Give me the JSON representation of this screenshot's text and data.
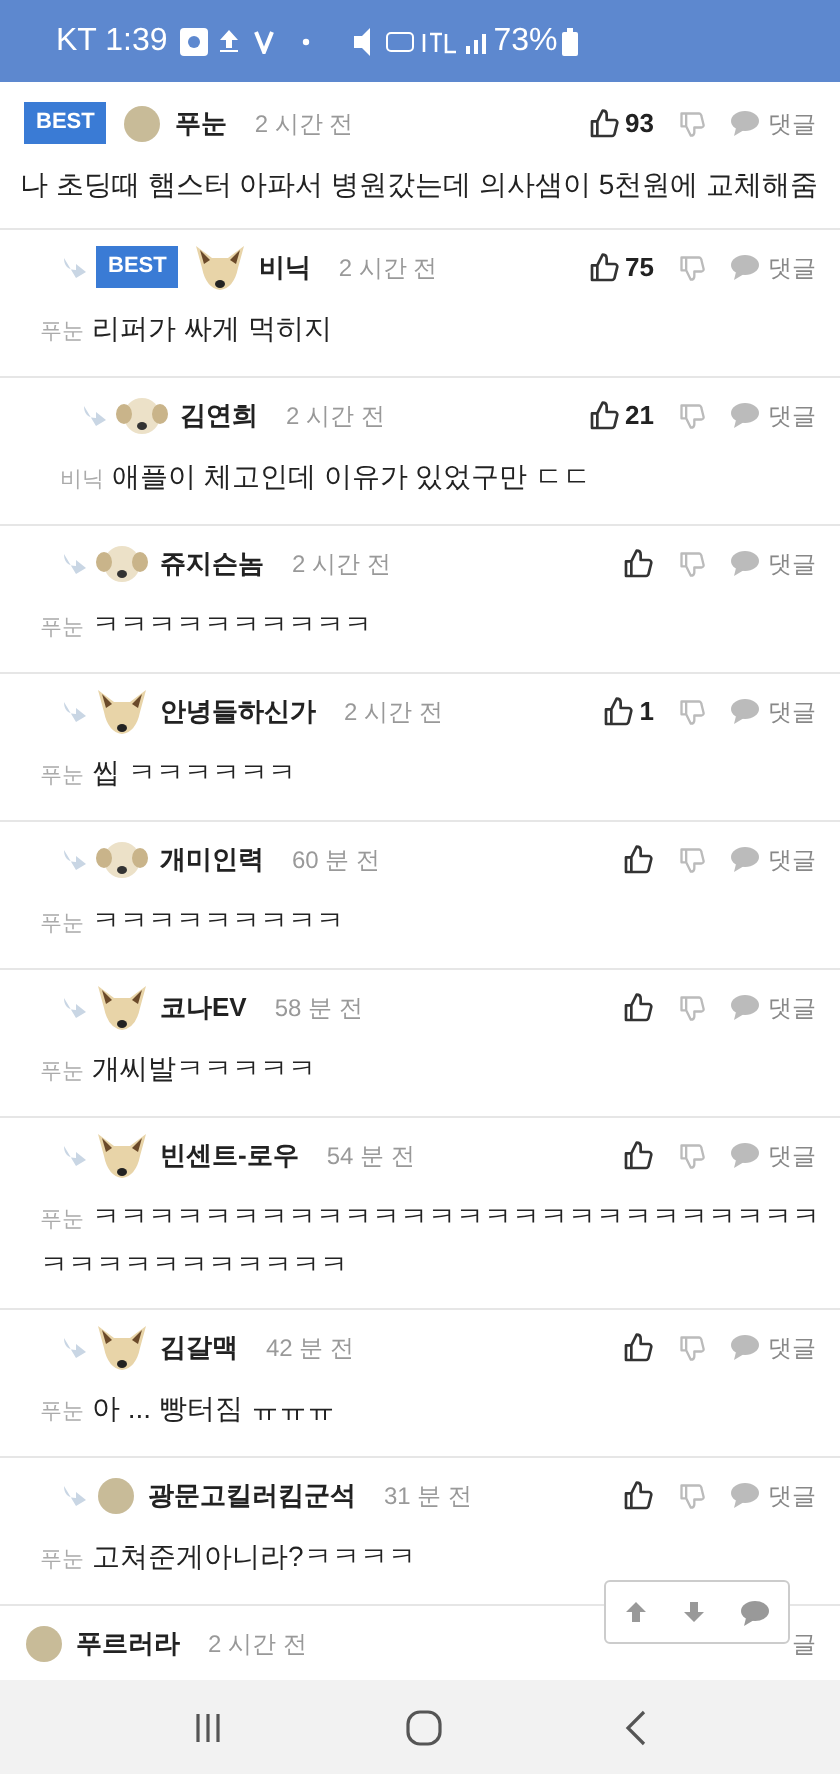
{
  "status_bar": {
    "carrier_time": "KT 1:39",
    "battery": "73%"
  },
  "comments": [
    {
      "badge": "BEST",
      "avatar": {
        "kind": "plain"
      },
      "author": "푸눈",
      "time": "2 시간 전",
      "likes": "93",
      "reply_label": "댓글",
      "text": "나 초딩때 햄스터 아파서 병원갔는데 의사샘이 5천원에 교체해줌",
      "children": [
        {
          "badge": "BEST",
          "avatar": {
            "kind": "dog"
          },
          "author": "비닉",
          "time": "2 시간 전",
          "likes": "75",
          "reply_label": "댓글",
          "mention": "푸눈",
          "text": "리퍼가 싸게 먹히지",
          "children": [
            {
              "avatar": {
                "kind": "puppy"
              },
              "author": "김연희",
              "time": "2 시간 전",
              "likes": "21",
              "reply_label": "댓글",
              "mention": "비닉",
              "text": "애플이 체고인데 이유가 있었구만 ㄷㄷ"
            }
          ]
        },
        {
          "avatar": {
            "kind": "puppy"
          },
          "author": "쥬지슨놈",
          "time": "2 시간 전",
          "reply_label": "댓글",
          "mention": "푸눈",
          "text": "ㅋㅋㅋㅋㅋㅋㅋㅋㅋㅋ"
        },
        {
          "avatar": {
            "kind": "dog"
          },
          "author": "안녕들하신가",
          "time": "2 시간 전",
          "likes": "1",
          "reply_label": "댓글",
          "mention": "푸눈",
          "text": "씹 ㅋㅋㅋㅋㅋㅋ"
        },
        {
          "avatar": {
            "kind": "puppy"
          },
          "author": "개미인력",
          "time": "60 분 전",
          "reply_label": "댓글",
          "mention": "푸눈",
          "text": "ㅋㅋㅋㅋㅋㅋㅋㅋㅋ"
        },
        {
          "avatar": {
            "kind": "dog"
          },
          "author": "코나EV",
          "time": "58 분 전",
          "reply_label": "댓글",
          "mention": "푸눈",
          "text": "개씨발ㅋㅋㅋㅋㅋ"
        },
        {
          "avatar": {
            "kind": "dog"
          },
          "author": "빈센트-로우",
          "time": "54 분 전",
          "reply_label": "댓글",
          "mention": "푸눈",
          "text": "ㅋㅋㅋㅋㅋㅋㅋㅋㅋㅋㅋㅋㅋㅋㅋㅋㅋㅋㅋㅋㅋㅋㅋㅋㅋㅋㅋㅋㅋㅋㅋㅋㅋㅋㅋㅋㅋ"
        },
        {
          "avatar": {
            "kind": "dog"
          },
          "author": "김갈맥",
          "time": "42 분 전",
          "reply_label": "댓글",
          "mention": "푸눈",
          "text": "아 ... 빵터짐 ㅠㅠㅠ"
        },
        {
          "avatar": {
            "kind": "plain"
          },
          "author": "광문고킬러킴군석",
          "time": "31 분 전",
          "reply_label": "댓글",
          "mention": "푸눈",
          "text": "고쳐준게아니라?ㅋㅋㅋㅋ"
        }
      ]
    },
    {
      "avatar": {
        "kind": "plain"
      },
      "author": "푸르러라",
      "time": "2 시간 전",
      "reply_label": "글",
      "kind": "covered"
    }
  ]
}
